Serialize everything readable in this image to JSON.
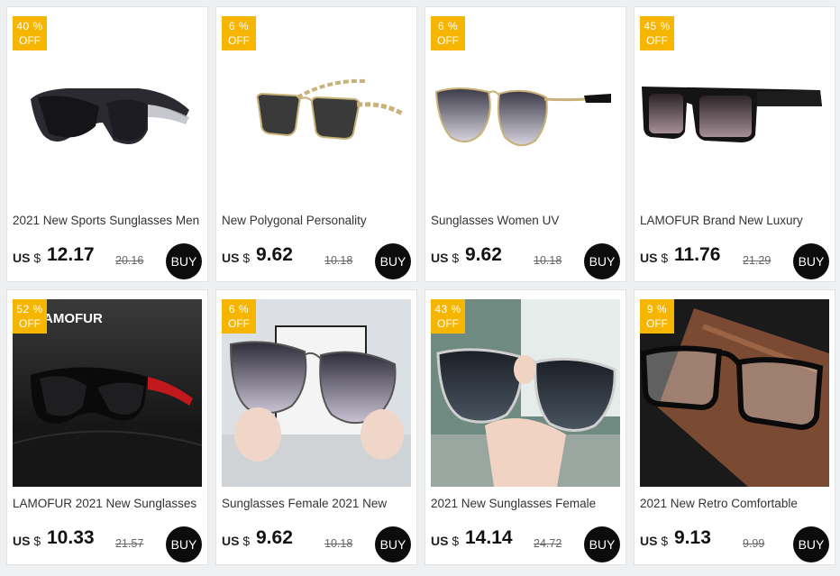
{
  "products": [
    {
      "discount_pct": "40 %",
      "off_label": "OFF",
      "image": "sports-wraparound-sunglasses",
      "title": "2021 New Sports Sunglasses Men",
      "currency": "US $",
      "price": "12.17",
      "old_price": "20.16",
      "buy_label": "BUY"
    },
    {
      "discount_pct": "6 %",
      "off_label": "OFF",
      "image": "gold-chain-polygon-sunglasses",
      "title": "New Polygonal Personality",
      "currency": "US $",
      "price": "9.62",
      "old_price": "10.18",
      "buy_label": "BUY"
    },
    {
      "discount_pct": "6 %",
      "off_label": "OFF",
      "image": "gradient-cat-eye-sunglasses",
      "title": "Sunglasses Women UV",
      "currency": "US $",
      "price": "9.62",
      "old_price": "10.18",
      "buy_label": "BUY"
    },
    {
      "discount_pct": "45 %",
      "off_label": "OFF",
      "image": "square-black-sunglasses",
      "title": "LAMOFUR Brand New Luxury",
      "currency": "US $",
      "price": "11.76",
      "old_price": "21.29",
      "buy_label": "BUY"
    },
    {
      "discount_pct": "52 %",
      "off_label": "OFF",
      "image": "polarized-sport-sunglasses-with-case",
      "brand_text": "AMOFUR",
      "title": "LAMOFUR 2021 New Sunglasses",
      "currency": "US $",
      "price": "10.33",
      "old_price": "21.57",
      "buy_label": "BUY"
    },
    {
      "discount_pct": "6 %",
      "off_label": "OFF",
      "image": "hand-holding-gradient-sunglasses",
      "title": "Sunglasses Female 2021 New",
      "currency": "US $",
      "price": "9.62",
      "old_price": "10.18",
      "buy_label": "BUY"
    },
    {
      "discount_pct": "43 %",
      "off_label": "OFF",
      "image": "hand-holding-dark-sunglasses",
      "title": "2021 New Sunglasses Female",
      "currency": "US $",
      "price": "14.14",
      "old_price": "24.72",
      "buy_label": "BUY"
    },
    {
      "discount_pct": "9 %",
      "off_label": "OFF",
      "image": "retro-reading-glasses-on-case",
      "title": "2021 New Retro Comfortable",
      "currency": "US $",
      "price": "9.13",
      "old_price": "9.99",
      "buy_label": "BUY"
    }
  ],
  "colors": {
    "badge": "#f6b500",
    "buy_button": "#0c0c0c",
    "page_bg": "#eef0f2"
  }
}
